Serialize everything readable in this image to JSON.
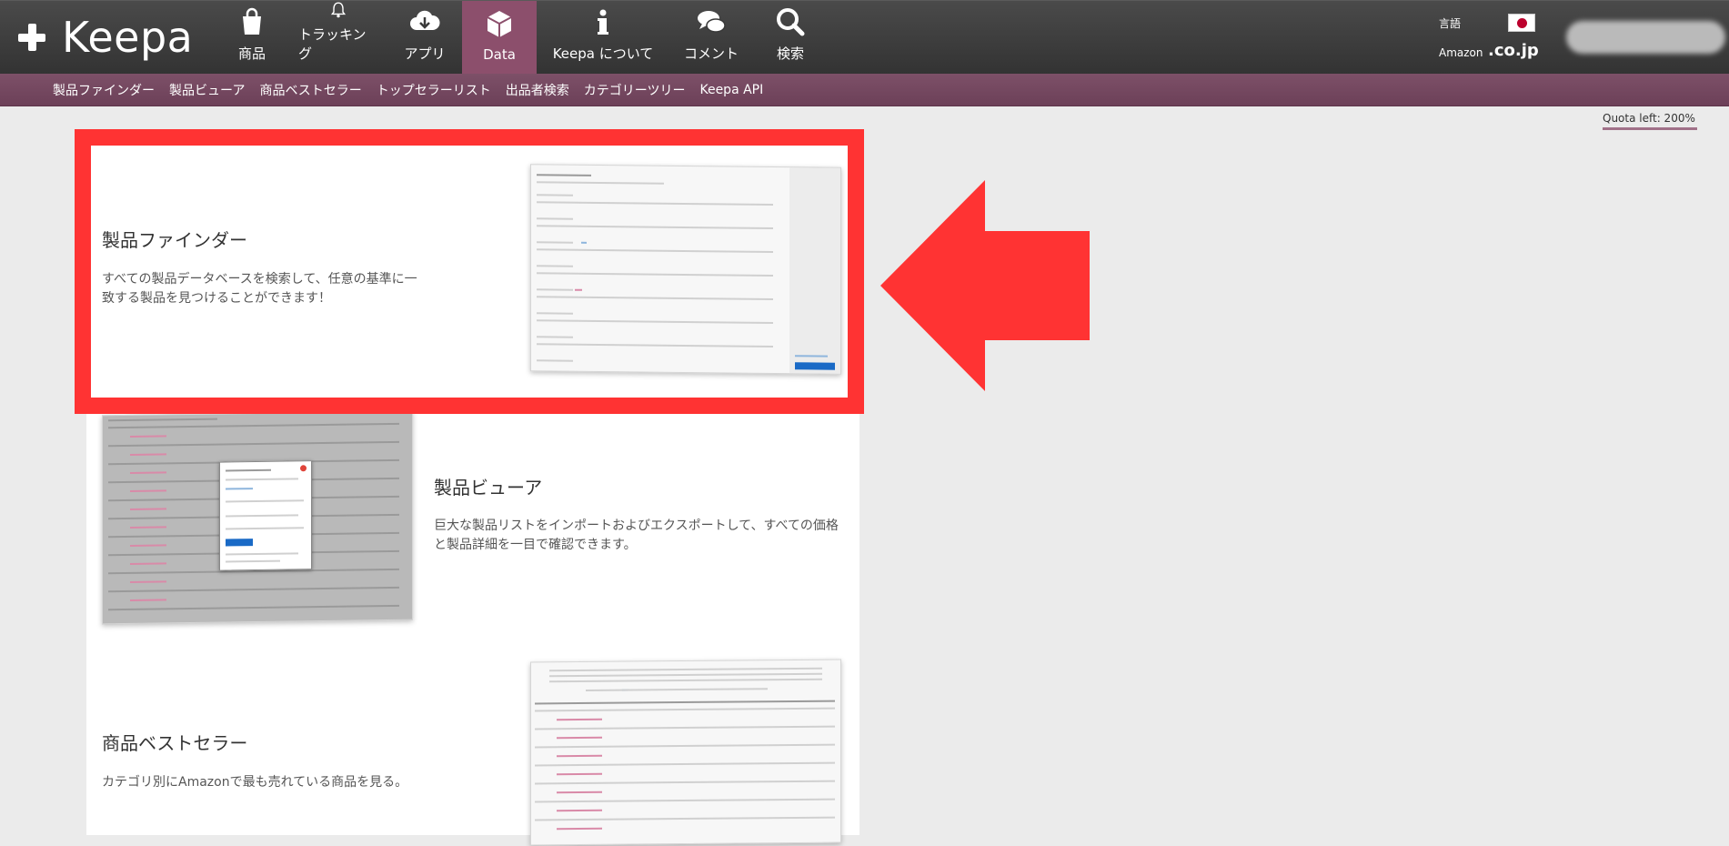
{
  "logo": {
    "text": "Keepa"
  },
  "nav": [
    {
      "label": "商品",
      "icon": "shopping-bag-icon"
    },
    {
      "label": "トラッキング",
      "icon": "bell-icon"
    },
    {
      "label": "アプリ",
      "icon": "cloud-download-icon"
    },
    {
      "label": "Data",
      "icon": "cube-icon",
      "active": true
    },
    {
      "label": "Keepa について",
      "icon": "info-icon"
    },
    {
      "label": "コメント",
      "icon": "speech-bubbles-icon"
    },
    {
      "label": "検索",
      "icon": "magnifier-icon"
    }
  ],
  "locale": {
    "language_label": "言語",
    "amazon_label": "Amazon",
    "domain": ".co.jp",
    "flag": "japan-flag-icon"
  },
  "subnav": [
    "製品ファインダー",
    "製品ビューア",
    "商品ベストセラー",
    "トップセラーリスト",
    "出品者検索",
    "カテゴリーツリー",
    "Keepa API"
  ],
  "quota": "Quota left: 200%",
  "cards": [
    {
      "title": "製品ファインダー",
      "description": "すべての製品データベースを検索して、任意の基準に一致する製品を見つけることができます！"
    },
    {
      "title": "製品ビューア",
      "description": "巨大な製品リストをインポートおよびエクスポートして、すべての価格と製品詳細を一目で確認できます。"
    },
    {
      "title": "商品ベストセラー",
      "description": "カテゴリ別にAmazonで最も売れている商品を見る。"
    }
  ],
  "colors": {
    "topbar": "#3a3a3a",
    "subbar": "#7d5068",
    "active_nav": "#8c4f6c",
    "highlight": "#ff3333"
  }
}
